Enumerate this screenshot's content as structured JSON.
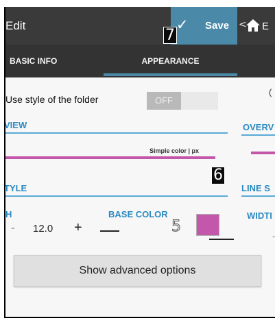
{
  "appbar": {
    "title": "Edit",
    "save_label": "Save",
    "save_icon": "checkmark-icon"
  },
  "markers": {
    "a": "7",
    "b": "6",
    "c": "5"
  },
  "tabs": [
    {
      "label": "BASIC INFO"
    },
    {
      "label": "APPEARANCE"
    }
  ],
  "style_folder": {
    "label": "Use style of the folder",
    "toggle": "OFF"
  },
  "sections": {
    "view": "VIEW",
    "style": "TYLE"
  },
  "preview": {
    "caption": "Simple color | px"
  },
  "line_settings": {
    "width_header": "H",
    "base_color_header": "BASE COLOR",
    "minus": "-",
    "width_value": "12.0",
    "plus": "+",
    "color_hex": "#c357ab"
  },
  "advanced_button": "Show advanced options",
  "peek": {
    "chevron": "<",
    "home_icon": "home-icon",
    "title_initial": "E",
    "col1_text": "(",
    "overview": "OVERV",
    "line_style": "LINE S",
    "width": "WIDTI",
    "dash": "-"
  },
  "colors": {
    "accent": "#4a8aa8",
    "section_blue": "#2b8ac2",
    "dark_bar": "#3a3a3a"
  }
}
